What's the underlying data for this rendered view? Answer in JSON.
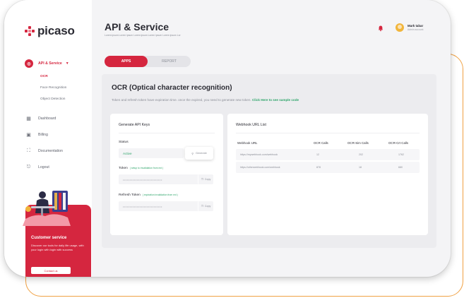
{
  "brand": {
    "name": "picaso",
    "accent": "#d5263f"
  },
  "sidebar": {
    "items": [
      {
        "label": "API & Service",
        "icon": "api-icon",
        "active": true,
        "children": [
          {
            "label": "OCR",
            "selected": true
          },
          {
            "label": "Face Recognition"
          },
          {
            "label": "Object Detection"
          }
        ]
      },
      {
        "label": "Dashboard",
        "icon": "grid-icon"
      },
      {
        "label": "Billing",
        "icon": "billing-icon"
      },
      {
        "label": "Documentation",
        "icon": "document-icon"
      },
      {
        "label": "Logout",
        "icon": "logout-icon"
      }
    ],
    "support": {
      "title": "Customer service",
      "text": "Discover our tools for daily life usage, with your login with login with success",
      "button": "Contact us"
    }
  },
  "header": {
    "title": "API & Service",
    "subtitle": "Lorem ipsum Lorem ipsum Lorem ipsum Lorem ipsum Lorem ipsum Lor",
    "user": {
      "name": "Mark tabar",
      "role": "Admin account"
    }
  },
  "tabs": [
    {
      "label": "APPS",
      "active": true
    },
    {
      "label": "REPORT",
      "active": false
    }
  ],
  "ocr": {
    "title": "OCR (Optical character recognition)",
    "description": "Token and refresh token have expiration time. once the expired, you need to generate new token.",
    "sample_link": "Click Here to see sample code"
  },
  "keys": {
    "title": "Generate API Keys",
    "status_label": "Status",
    "status_value": "Active",
    "generate_label": "Generate",
    "token_label": "Token",
    "token_hint": "( setup to invalidation from ext )",
    "token_value": "••••••••••••••••••••••••••••",
    "refresh_label": "Refresh Token",
    "refresh_hint": "( expiration invalidation from ext )",
    "refresh_value": "••••••••••••••••••••••••••••",
    "copy_label": "Copy"
  },
  "webhooks": {
    "title": "Webhook URL List",
    "columns": [
      "Webhook URL",
      "OCR Calls",
      "OCR-Sim Calls",
      "OCR-Crt Calls"
    ],
    "rows": [
      [
        "https://mywebhook.com/webhook",
        "12",
        "202",
        "1762"
      ],
      [
        "https://otherwebhook.com/webhook",
        "878",
        "18",
        "680"
      ]
    ]
  }
}
